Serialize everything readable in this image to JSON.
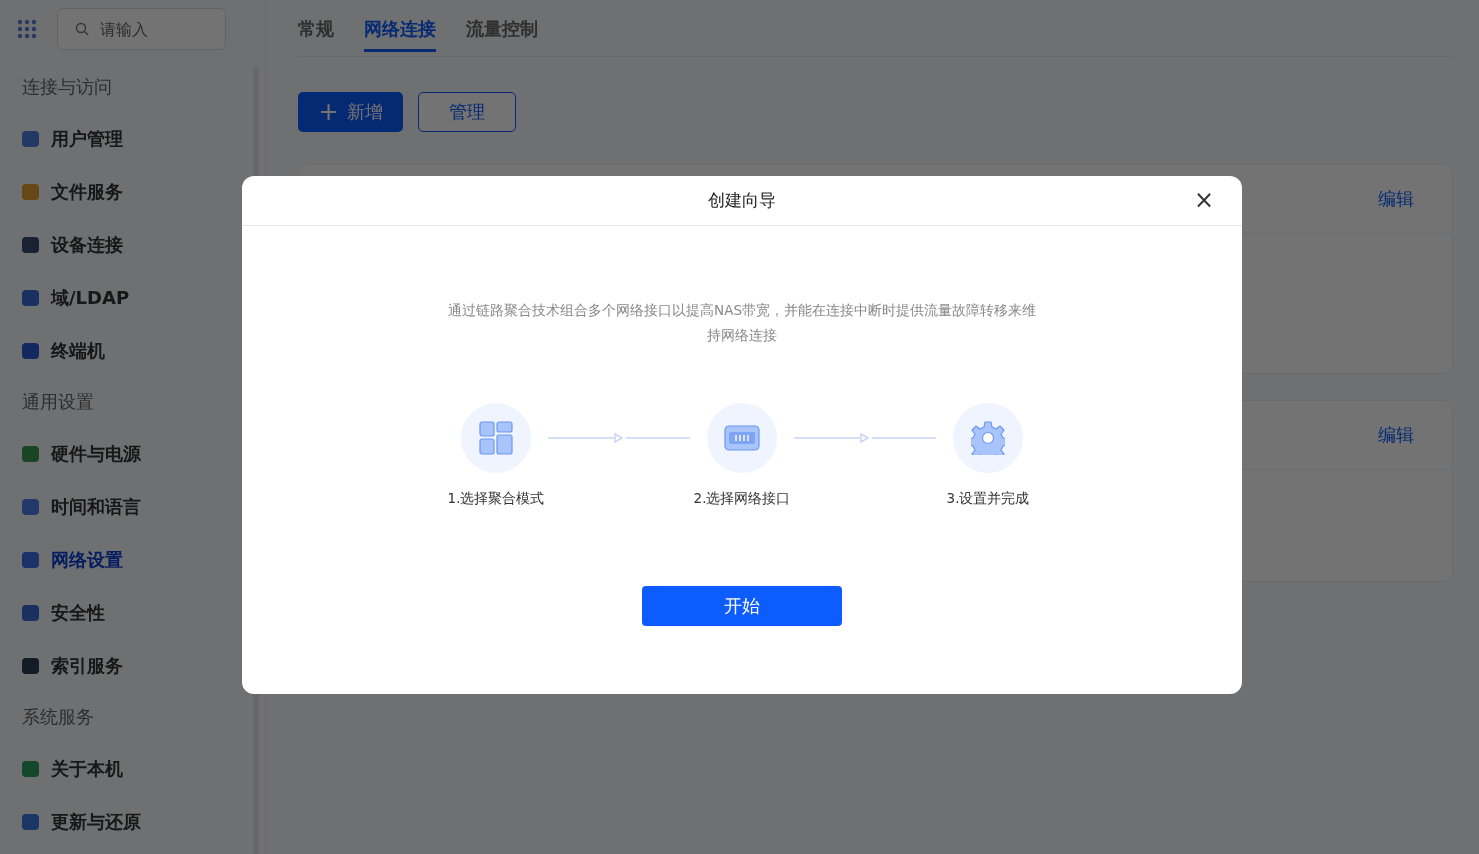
{
  "search": {
    "placeholder": "请输入"
  },
  "sidebar": {
    "sections": [
      {
        "title": "连接与访问",
        "items": [
          {
            "label": "用户管理",
            "selected": false
          },
          {
            "label": "文件服务",
            "selected": false
          },
          {
            "label": "设备连接",
            "selected": false
          },
          {
            "label": "域/LDAP",
            "selected": false
          },
          {
            "label": "终端机",
            "selected": false
          }
        ]
      },
      {
        "title": "通用设置",
        "items": [
          {
            "label": "硬件与电源",
            "selected": false
          },
          {
            "label": "时间和语言",
            "selected": false
          },
          {
            "label": "网络设置",
            "selected": true
          },
          {
            "label": "安全性",
            "selected": false
          },
          {
            "label": "索引服务",
            "selected": false
          }
        ]
      },
      {
        "title": "系统服务",
        "items": [
          {
            "label": "关于本机",
            "selected": false
          },
          {
            "label": "更新与还原",
            "selected": false
          }
        ]
      }
    ]
  },
  "tabs": [
    {
      "label": "常规",
      "selected": false
    },
    {
      "label": "网络连接",
      "selected": true
    },
    {
      "label": "流量控制",
      "selected": false
    }
  ],
  "toolbar": {
    "add_button": {
      "icon": "+",
      "label": "新增"
    },
    "manage_button": "管理"
  },
  "cards": [
    {
      "action": "编辑"
    },
    {
      "action": "编辑"
    }
  ],
  "dialog": {
    "title": "创建向导",
    "close": "×",
    "description": "通过链路聚合技术组合多个网络接口以提高NAS带宽，并能在连接中断时提供流量故障转移来维持网络连接",
    "steps": [
      {
        "kind": "layout",
        "label": "1.选择聚合模式"
      },
      {
        "kind": "port",
        "label": "2.选择网络接口"
      },
      {
        "kind": "gear",
        "label": "3.设置并完成"
      }
    ],
    "start_button": "开始"
  }
}
